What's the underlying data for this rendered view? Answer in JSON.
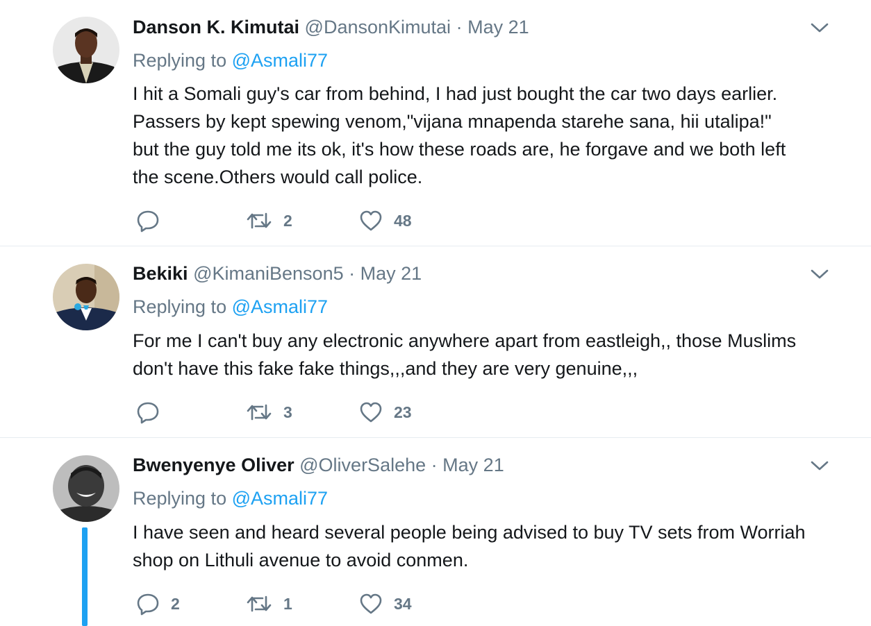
{
  "colors": {
    "accent": "#1da1f2",
    "muted": "#657786",
    "text": "#14171a",
    "divider": "#e6ecf0"
  },
  "tweets": [
    {
      "name": "Danson K. Kimutai",
      "handle": "@DansonKimutai",
      "separator": "·",
      "date": "May 21",
      "replying_prefix": "Replying to",
      "replying_to": "@Asmali77",
      "lines": [
        "I hit a Somali guy's car from behind, I had just bought the car two days earlier.",
        "Passers by kept spewing venom,\"vijana mnapenda starehe sana, hii utalipa!\"",
        "but the guy told me its ok, it's how these roads are, he forgave and we both left",
        "the scene.Others would call police."
      ],
      "reply_count": "",
      "retweet_count": "2",
      "like_count": "48"
    },
    {
      "name": "Bekiki",
      "handle": "@KimaniBenson5",
      "separator": "·",
      "date": "May 21",
      "replying_prefix": "Replying to",
      "replying_to": "@Asmali77",
      "lines": [
        "For me I can't buy any electronic anywhere apart from eastleigh,, those Muslims",
        "don't have this fake fake things,,,and they are very genuine,,,"
      ],
      "reply_count": "",
      "retweet_count": "3",
      "like_count": "23"
    },
    {
      "name": "Bwenyenye Oliver",
      "handle": "@OliverSalehe",
      "separator": "·",
      "date": "May 21",
      "replying_prefix": "Replying to",
      "replying_to": "@Asmali77",
      "lines": [
        "I have seen and heard several people being advised to buy TV sets from Worriah",
        "shop on Lithuli avenue to avoid conmen."
      ],
      "reply_count": "2",
      "retweet_count": "1",
      "like_count": "34"
    }
  ]
}
